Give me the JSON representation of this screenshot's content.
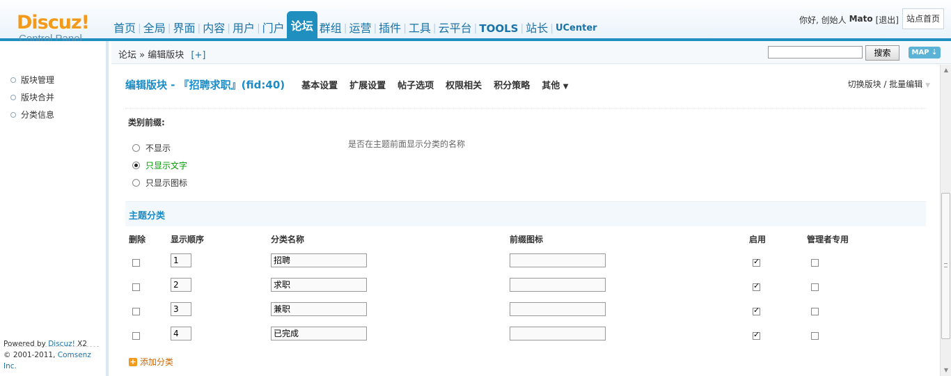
{
  "header": {
    "logo_text": "Discuz!",
    "logo_sub": "Control Panel",
    "nav": [
      "首页",
      "全局",
      "界面",
      "内容",
      "用户",
      "门户",
      "论坛",
      "群组",
      "运营",
      "插件",
      "工具",
      "云平台",
      "TOOLS",
      "站长",
      "UCenter"
    ],
    "active_nav": "论坛",
    "greeting": "你好, 创始人",
    "username": "Mato",
    "logout": "[退出]",
    "home_button": "站点首页"
  },
  "breadcrumb": {
    "root": "论坛",
    "sep": "»",
    "current": "编辑版块",
    "add": "[+]",
    "search_button": "搜索",
    "map_button": "MAP ⇣"
  },
  "sidebar": {
    "items": [
      "版块管理",
      "版块合并",
      "分类信息"
    ],
    "powered_prefix": "Powered by",
    "powered_link": "Discuz!",
    "powered_version": "X2",
    "copyright_prefix": "© 2001-2011,",
    "copyright_link": "Comsenz Inc."
  },
  "main": {
    "title": "编辑版块 - 『招聘求职』(fid:40)",
    "tabs": [
      "基本设置",
      "扩展设置",
      "帖子选项",
      "权限相关",
      "积分策略",
      "其他"
    ],
    "right_links": "切换版块 / 批量编辑",
    "prefix_label": "类别前缀:",
    "prefix_options": [
      "不显示",
      "只显示文字",
      "只显示图标"
    ],
    "prefix_selected": 1,
    "prefix_help": "是否在主题前面显示分类的名称",
    "section_title": "主题分类",
    "columns": [
      "删除",
      "显示顺序",
      "分类名称",
      "前缀图标",
      "启用",
      "管理者专用"
    ],
    "rows": [
      {
        "order": "1",
        "name": "招聘",
        "icon": "",
        "enabled": true,
        "mod_only": false
      },
      {
        "order": "2",
        "name": "求职",
        "icon": "",
        "enabled": true,
        "mod_only": false
      },
      {
        "order": "3",
        "name": "兼职",
        "icon": "",
        "enabled": true,
        "mod_only": false
      },
      {
        "order": "4",
        "name": "已完成",
        "icon": "",
        "enabled": true,
        "mod_only": false
      }
    ],
    "add_category": "添加分类"
  }
}
